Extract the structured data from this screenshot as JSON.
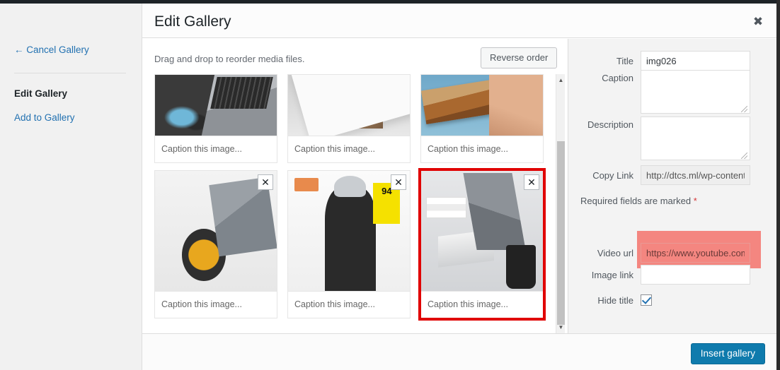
{
  "admin": {
    "bar_color": "#1d2327"
  },
  "sidebar": {
    "cancel": "← Cancel Gallery",
    "items": [
      {
        "label": "Edit Gallery",
        "active": true
      },
      {
        "label": "Add to Gallery",
        "active": false
      }
    ]
  },
  "modal": {
    "title": "Edit Gallery",
    "close_icon": "close-icon",
    "close_glyph": "✖"
  },
  "media": {
    "drag_hint": "Drag and drop to reorder media files.",
    "reverse_button": "Reverse order",
    "remove_glyph": "✕",
    "attachments": [
      {
        "caption_placeholder": "Caption this image...",
        "removable": false,
        "selected": false
      },
      {
        "caption_placeholder": "Caption this image...",
        "removable": false,
        "selected": false
      },
      {
        "caption_placeholder": "Caption this image...",
        "removable": false,
        "selected": false
      },
      {
        "caption_placeholder": "Caption this image...",
        "removable": true,
        "selected": false
      },
      {
        "caption_placeholder": "Caption this image...",
        "removable": true,
        "selected": false
      },
      {
        "caption_placeholder": "Caption this image...",
        "removable": true,
        "selected": true
      }
    ]
  },
  "details": {
    "title_label": "Title",
    "title_value": "img026",
    "caption_label": "Caption",
    "caption_value": "",
    "description_label": "Description",
    "description_value": "",
    "copy_link_label": "Copy Link",
    "copy_link_value": "http://dtcs.ml/wp-content/u",
    "required_note": "Required fields are marked",
    "required_star": "*",
    "video_url_label": "Video url",
    "video_url_value": "https://www.youtube.com/\\",
    "image_link_label": "Image link",
    "image_link_value": "",
    "hide_title_label": "Hide title",
    "hide_title_checked": true,
    "highlight_color": "#f4665f"
  },
  "footer": {
    "insert_button": "Insert gallery",
    "accent_color": "#0f7bad"
  },
  "scrollbars": {
    "up_glyph": "▲",
    "down_glyph": "▼"
  }
}
